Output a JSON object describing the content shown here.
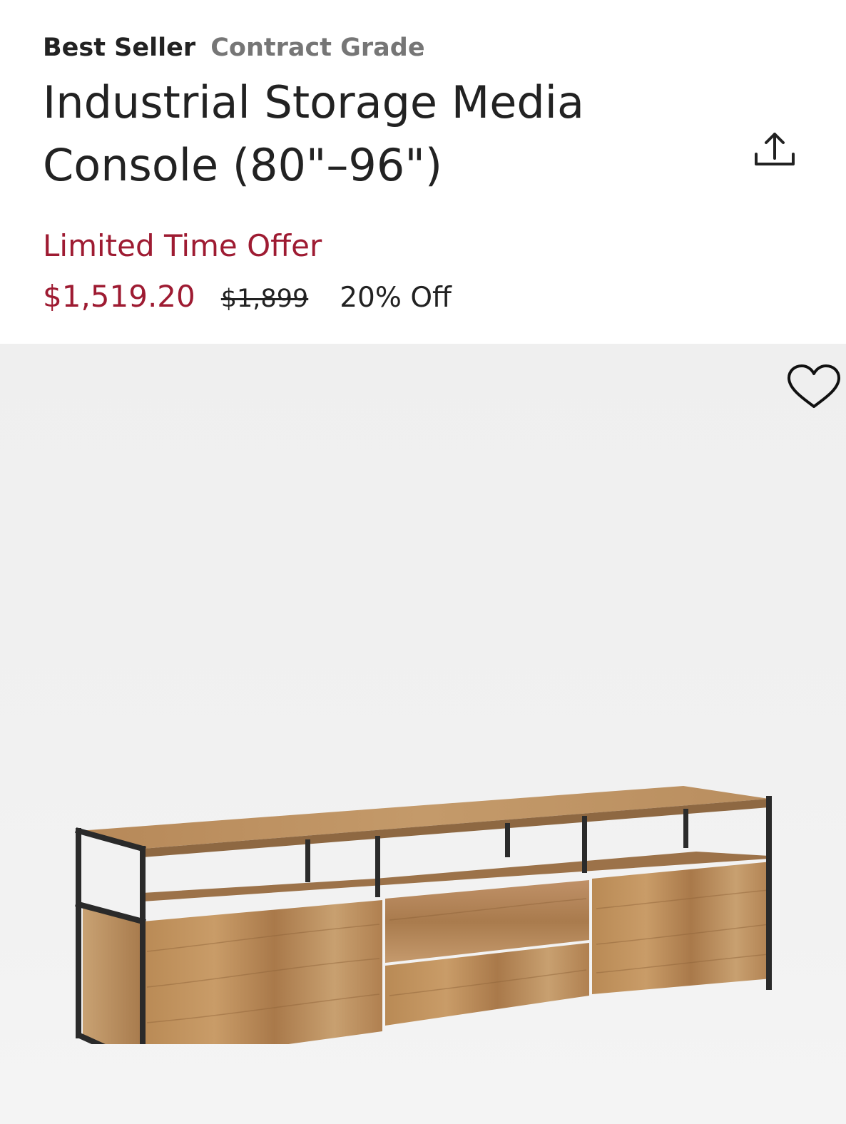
{
  "badges": {
    "best_seller": "Best Seller",
    "contract_grade": "Contract Grade"
  },
  "product": {
    "title": "Industrial Storage Media Console (80\"–96\")",
    "offer_label": "Limited Time Offer",
    "sale_price": "$1,519.20",
    "original_price": "$1,899",
    "discount": "20% Off"
  },
  "colors": {
    "accent": "#9e1b32",
    "muted": "#767676",
    "text": "#222222",
    "image_background": "#f0f0f0"
  },
  "icons": {
    "share": "share-icon",
    "favorite": "heart-icon"
  }
}
